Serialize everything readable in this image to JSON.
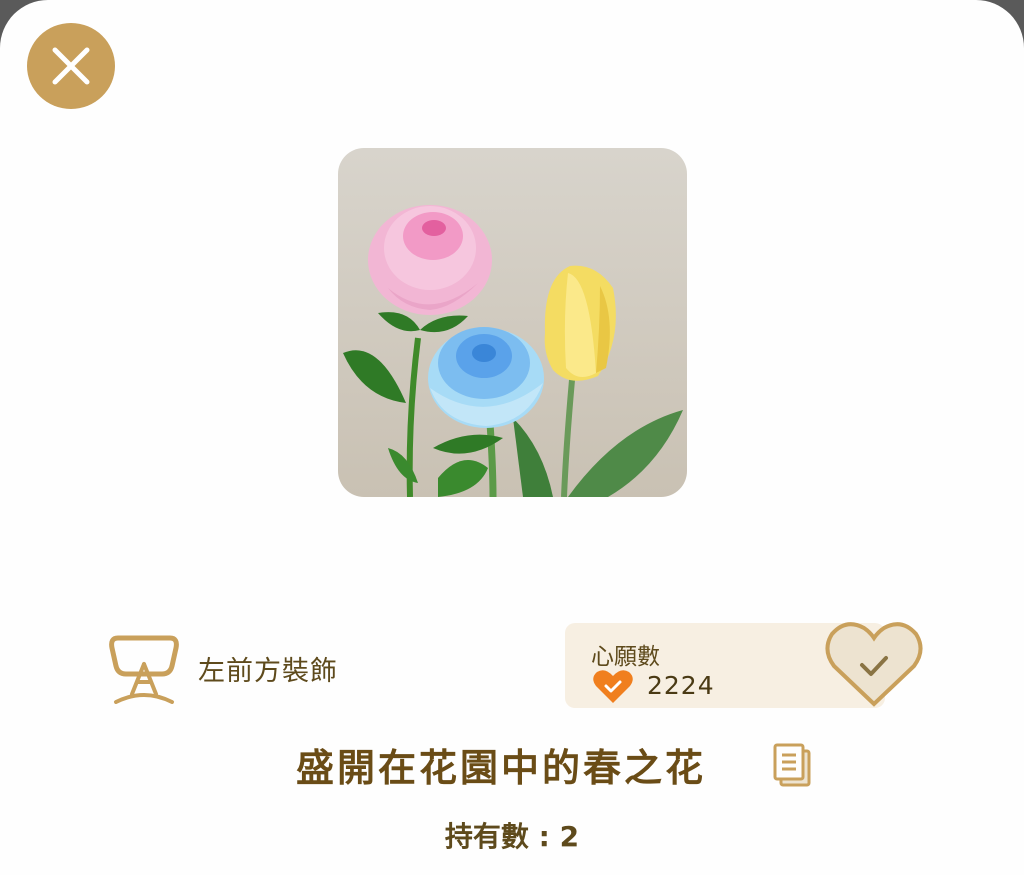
{
  "colors": {
    "accent_gold": "#c9a05b",
    "text_brown": "#5e4a1c",
    "title_brown": "#6a4c16",
    "wish_panel_bg": "#f7efe2",
    "heart_orange": "#f07f1e"
  },
  "icons": {
    "close": "close-icon",
    "category": "mannequin-icon",
    "wish_small": "heart-check-icon",
    "wish_button": "heart-check-icon",
    "copy": "copy-icon"
  },
  "item": {
    "image_alt": "flower bouquet",
    "name": "盛開在花園中的春之花",
    "category": "左前方裝飾",
    "owned_label": "持有數 : 2"
  },
  "wish": {
    "title": "心願數",
    "count": "2224"
  }
}
